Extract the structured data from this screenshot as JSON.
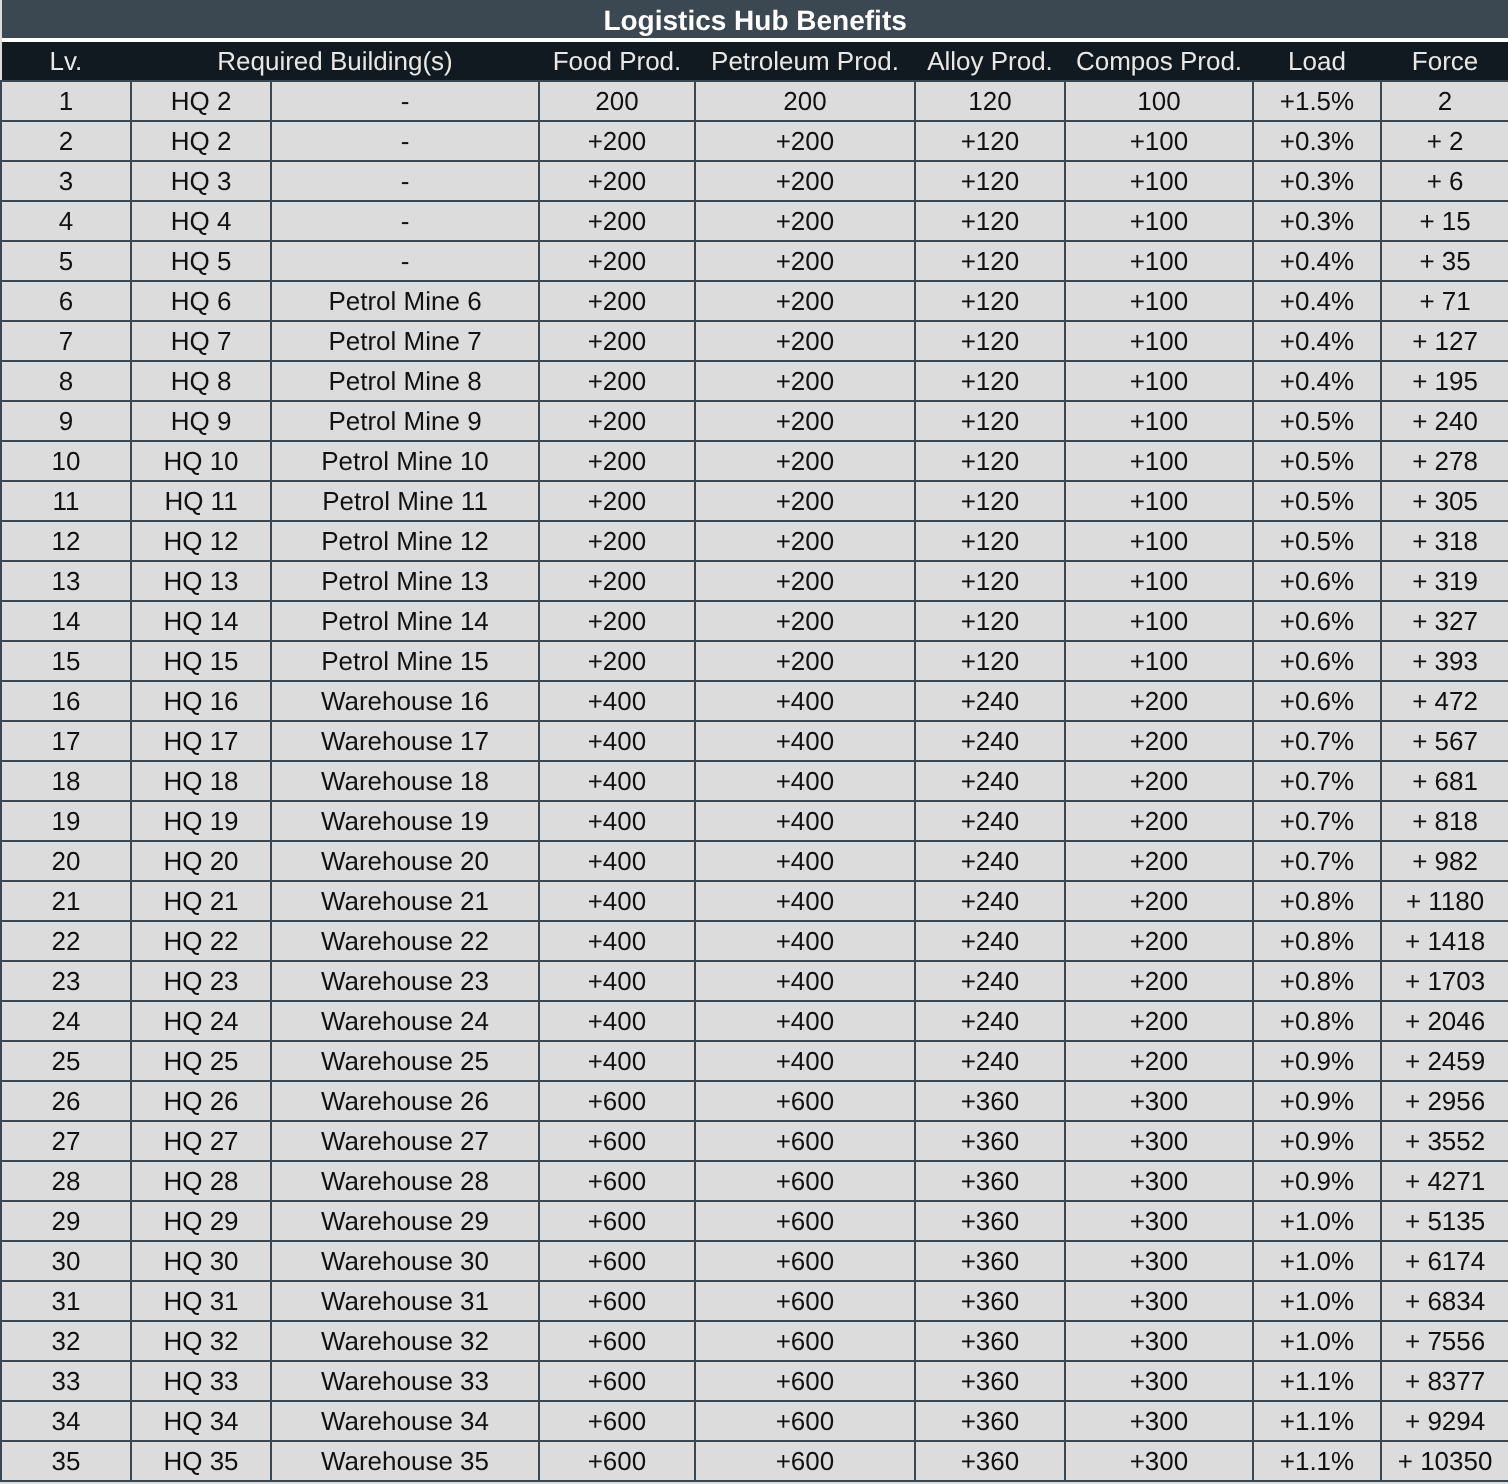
{
  "table": {
    "title": "Logistics Hub Benefits",
    "columns": [
      "Lv.",
      "Required Building(s)",
      "Food Prod.",
      "Petroleum Prod.",
      "Alloy Prod.",
      "Compos Prod.",
      "Load",
      "Force"
    ],
    "rows": [
      [
        "1",
        [
          "HQ 2",
          "-"
        ],
        "200",
        "200",
        "120",
        "100",
        "+1.5%",
        "2"
      ],
      [
        "2",
        [
          "HQ 2",
          "-"
        ],
        "+200",
        "+200",
        "+120",
        "+100",
        "+0.3%",
        "+ 2"
      ],
      [
        "3",
        [
          "HQ 3",
          "-"
        ],
        "+200",
        "+200",
        "+120",
        "+100",
        "+0.3%",
        "+ 6"
      ],
      [
        "4",
        [
          "HQ 4",
          "-"
        ],
        "+200",
        "+200",
        "+120",
        "+100",
        "+0.3%",
        "+ 15"
      ],
      [
        "5",
        [
          "HQ 5",
          "-"
        ],
        "+200",
        "+200",
        "+120",
        "+100",
        "+0.4%",
        "+ 35"
      ],
      [
        "6",
        [
          "HQ 6",
          "Petrol Mine 6"
        ],
        "+200",
        "+200",
        "+120",
        "+100",
        "+0.4%",
        "+ 71"
      ],
      [
        "7",
        [
          "HQ 7",
          "Petrol Mine 7"
        ],
        "+200",
        "+200",
        "+120",
        "+100",
        "+0.4%",
        "+ 127"
      ],
      [
        "8",
        [
          "HQ 8",
          "Petrol Mine 8"
        ],
        "+200",
        "+200",
        "+120",
        "+100",
        "+0.4%",
        "+ 195"
      ],
      [
        "9",
        [
          "HQ 9",
          "Petrol Mine 9"
        ],
        "+200",
        "+200",
        "+120",
        "+100",
        "+0.5%",
        "+ 240"
      ],
      [
        "10",
        [
          "HQ 10",
          "Petrol Mine 10"
        ],
        "+200",
        "+200",
        "+120",
        "+100",
        "+0.5%",
        "+ 278"
      ],
      [
        "11",
        [
          "HQ 11",
          "Petrol Mine 11"
        ],
        "+200",
        "+200",
        "+120",
        "+100",
        "+0.5%",
        "+ 305"
      ],
      [
        "12",
        [
          "HQ 12",
          "Petrol Mine 12"
        ],
        "+200",
        "+200",
        "+120",
        "+100",
        "+0.5%",
        "+ 318"
      ],
      [
        "13",
        [
          "HQ 13",
          "Petrol Mine 13"
        ],
        "+200",
        "+200",
        "+120",
        "+100",
        "+0.6%",
        "+ 319"
      ],
      [
        "14",
        [
          "HQ 14",
          "Petrol Mine 14"
        ],
        "+200",
        "+200",
        "+120",
        "+100",
        "+0.6%",
        "+ 327"
      ],
      [
        "15",
        [
          "HQ 15",
          "Petrol Mine 15"
        ],
        "+200",
        "+200",
        "+120",
        "+100",
        "+0.6%",
        "+ 393"
      ],
      [
        "16",
        [
          "HQ 16",
          "Warehouse 16"
        ],
        "+400",
        "+400",
        "+240",
        "+200",
        "+0.6%",
        "+ 472"
      ],
      [
        "17",
        [
          "HQ 17",
          "Warehouse 17"
        ],
        "+400",
        "+400",
        "+240",
        "+200",
        "+0.7%",
        "+ 567"
      ],
      [
        "18",
        [
          "HQ 18",
          "Warehouse 18"
        ],
        "+400",
        "+400",
        "+240",
        "+200",
        "+0.7%",
        "+ 681"
      ],
      [
        "19",
        [
          "HQ 19",
          "Warehouse 19"
        ],
        "+400",
        "+400",
        "+240",
        "+200",
        "+0.7%",
        "+ 818"
      ],
      [
        "20",
        [
          "HQ 20",
          "Warehouse 20"
        ],
        "+400",
        "+400",
        "+240",
        "+200",
        "+0.7%",
        "+ 982"
      ],
      [
        "21",
        [
          "HQ 21",
          "Warehouse 21"
        ],
        "+400",
        "+400",
        "+240",
        "+200",
        "+0.8%",
        "+ 1180"
      ],
      [
        "22",
        [
          "HQ 22",
          "Warehouse 22"
        ],
        "+400",
        "+400",
        "+240",
        "+200",
        "+0.8%",
        "+ 1418"
      ],
      [
        "23",
        [
          "HQ 23",
          "Warehouse 23"
        ],
        "+400",
        "+400",
        "+240",
        "+200",
        "+0.8%",
        "+ 1703"
      ],
      [
        "24",
        [
          "HQ 24",
          "Warehouse 24"
        ],
        "+400",
        "+400",
        "+240",
        "+200",
        "+0.8%",
        "+ 2046"
      ],
      [
        "25",
        [
          "HQ 25",
          "Warehouse 25"
        ],
        "+400",
        "+400",
        "+240",
        "+200",
        "+0.9%",
        "+ 2459"
      ],
      [
        "26",
        [
          "HQ 26",
          "Warehouse 26"
        ],
        "+600",
        "+600",
        "+360",
        "+300",
        "+0.9%",
        "+ 2956"
      ],
      [
        "27",
        [
          "HQ 27",
          "Warehouse 27"
        ],
        "+600",
        "+600",
        "+360",
        "+300",
        "+0.9%",
        "+ 3552"
      ],
      [
        "28",
        [
          "HQ 28",
          "Warehouse 28"
        ],
        "+600",
        "+600",
        "+360",
        "+300",
        "+0.9%",
        "+ 4271"
      ],
      [
        "29",
        [
          "HQ 29",
          "Warehouse 29"
        ],
        "+600",
        "+600",
        "+360",
        "+300",
        "+1.0%",
        "+ 5135"
      ],
      [
        "30",
        [
          "HQ 30",
          "Warehouse 30"
        ],
        "+600",
        "+600",
        "+360",
        "+300",
        "+1.0%",
        "+ 6174"
      ],
      [
        "31",
        [
          "HQ 31",
          "Warehouse 31"
        ],
        "+600",
        "+600",
        "+360",
        "+300",
        "+1.0%",
        "+ 6834"
      ],
      [
        "32",
        [
          "HQ 32",
          "Warehouse 32"
        ],
        "+600",
        "+600",
        "+360",
        "+300",
        "+1.0%",
        "+ 7556"
      ],
      [
        "33",
        [
          "HQ 33",
          "Warehouse 33"
        ],
        "+600",
        "+600",
        "+360",
        "+300",
        "+1.1%",
        "+ 8377"
      ],
      [
        "34",
        [
          "HQ 34",
          "Warehouse 34"
        ],
        "+600",
        "+600",
        "+360",
        "+300",
        "+1.1%",
        "+ 9294"
      ],
      [
        "35",
        [
          "HQ 35",
          "Warehouse 35"
        ],
        "+600",
        "+600",
        "+360",
        "+300",
        "+1.1%",
        "+ 10350"
      ]
    ]
  }
}
